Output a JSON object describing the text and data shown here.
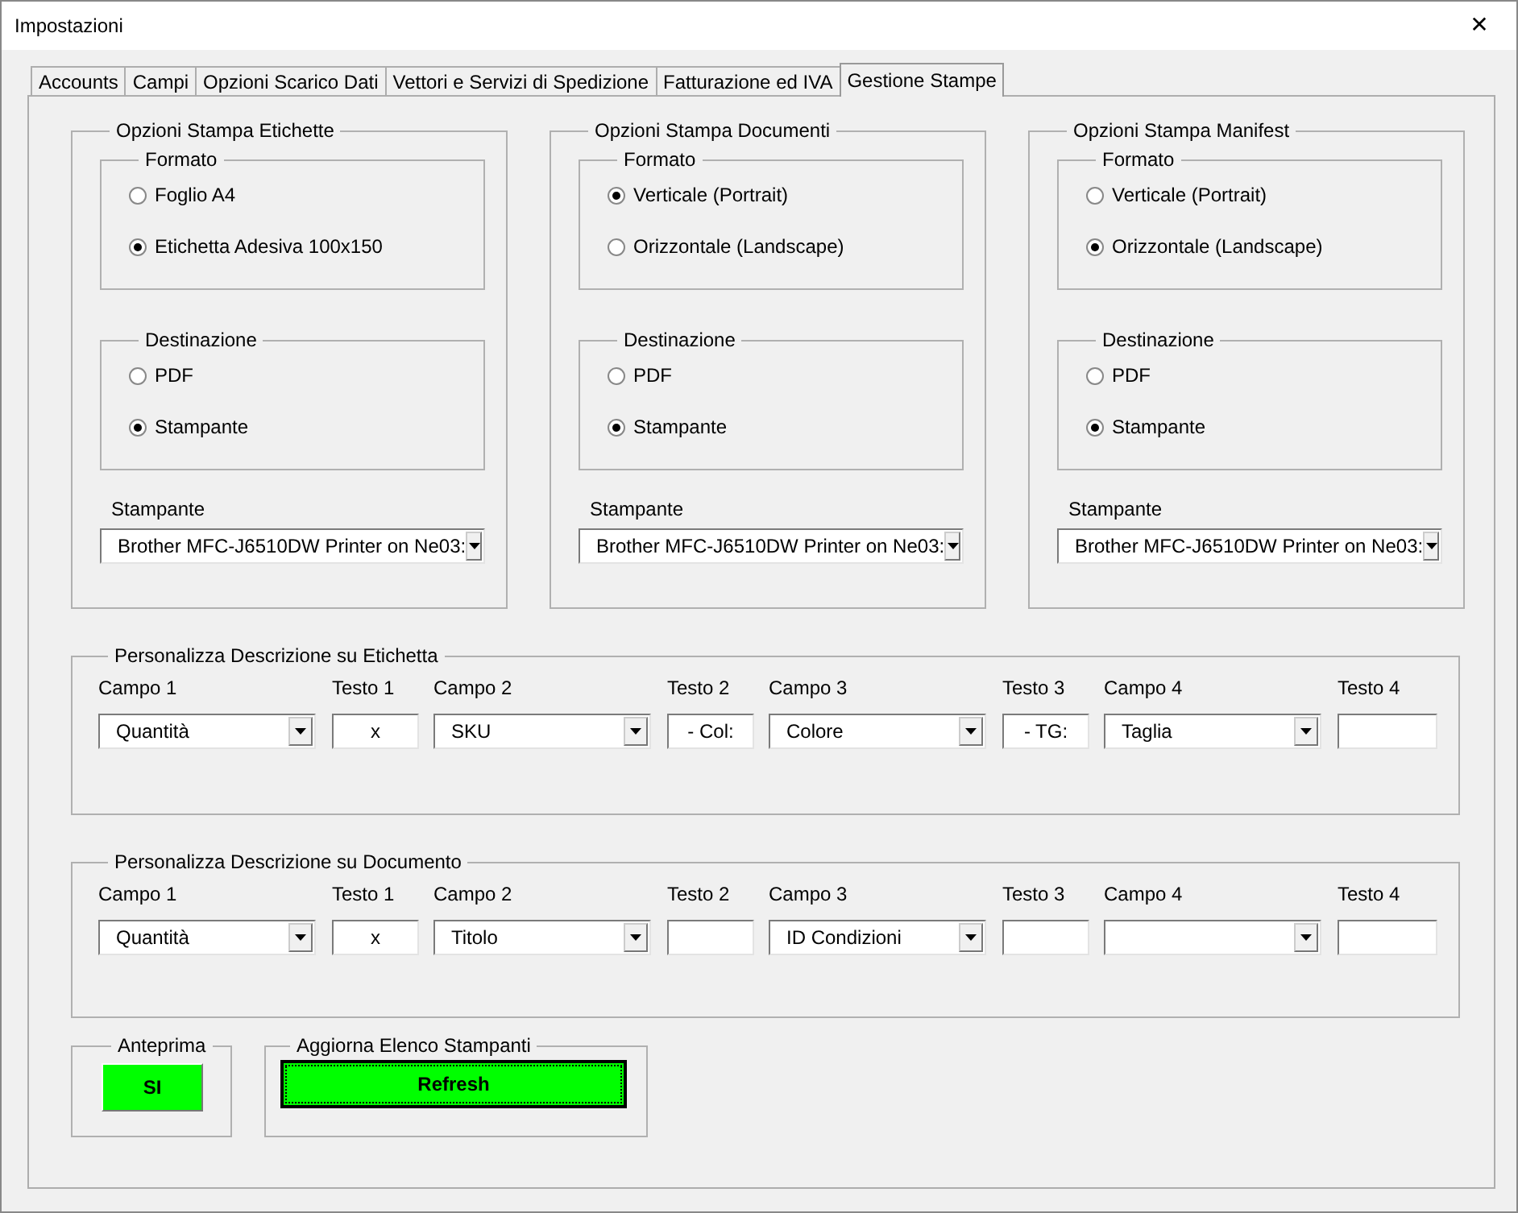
{
  "window": {
    "title": "Impostazioni",
    "close": "✕"
  },
  "tabs": [
    {
      "label": "Accounts",
      "selected": false
    },
    {
      "label": "Campi",
      "selected": false
    },
    {
      "label": "Opzioni Scarico Dati",
      "selected": false
    },
    {
      "label": "Vettori e Servizi di Spedizione",
      "selected": false
    },
    {
      "label": "Fatturazione ed IVA",
      "selected": false
    },
    {
      "label": "Gestione Stampe",
      "selected": true
    }
  ],
  "print_options": [
    {
      "title": "Opzioni Stampa Etichette",
      "format": {
        "title": "Formato",
        "options": [
          {
            "label": "Foglio A4",
            "selected": false
          },
          {
            "label": "Etichetta Adesiva 100x150",
            "selected": true
          }
        ]
      },
      "destination": {
        "title": "Destinazione",
        "options": [
          {
            "label": "PDF",
            "selected": false
          },
          {
            "label": "Stampante",
            "selected": true
          }
        ]
      },
      "printer_label": "Stampante",
      "printer": "Brother MFC-J6510DW Printer on Ne03:"
    },
    {
      "title": "Opzioni Stampa Documenti",
      "format": {
        "title": "Formato",
        "options": [
          {
            "label": "Verticale (Portrait)",
            "selected": true
          },
          {
            "label": "Orizzontale (Landscape)",
            "selected": false
          }
        ]
      },
      "destination": {
        "title": "Destinazione",
        "options": [
          {
            "label": "PDF",
            "selected": false
          },
          {
            "label": "Stampante",
            "selected": true
          }
        ]
      },
      "printer_label": "Stampante",
      "printer": "Brother MFC-J6510DW Printer on Ne03:"
    },
    {
      "title": "Opzioni Stampa Manifest",
      "format": {
        "title": "Formato",
        "options": [
          {
            "label": "Verticale (Portrait)",
            "selected": false
          },
          {
            "label": "Orizzontale (Landscape)",
            "selected": true
          }
        ]
      },
      "destination": {
        "title": "Destinazione",
        "options": [
          {
            "label": "PDF",
            "selected": false
          },
          {
            "label": "Stampante",
            "selected": true
          }
        ]
      },
      "printer_label": "Stampante",
      "printer": "Brother MFC-J6510DW Printer on Ne03:"
    }
  ],
  "descriptions": [
    {
      "title": "Personalizza Descrizione su Etichetta",
      "fields": [
        {
          "kind": "combo",
          "label": "Campo 1",
          "value": "Quantità"
        },
        {
          "kind": "text",
          "label": "Testo 1",
          "value": "x"
        },
        {
          "kind": "combo",
          "label": "Campo 2",
          "value": "SKU"
        },
        {
          "kind": "text",
          "label": "Testo 2",
          "value": "- Col:"
        },
        {
          "kind": "combo",
          "label": "Campo 3",
          "value": "Colore"
        },
        {
          "kind": "text",
          "label": "Testo 3",
          "value": "- TG:"
        },
        {
          "kind": "combo",
          "label": "Campo 4",
          "value": "Taglia"
        },
        {
          "kind": "text",
          "label": "Testo 4"
        }
      ]
    },
    {
      "title": "Personalizza Descrizione su Documento",
      "fields": [
        {
          "kind": "combo",
          "label": "Campo 1",
          "value": "Quantità"
        },
        {
          "kind": "text",
          "label": "Testo 1",
          "value": "x"
        },
        {
          "kind": "combo",
          "label": "Campo 2",
          "value": "Titolo"
        },
        {
          "kind": "text",
          "label": "Testo 2"
        },
        {
          "kind": "combo",
          "label": "Campo 3",
          "value": "ID Condizioni"
        },
        {
          "kind": "text",
          "label": "Testo 3"
        },
        {
          "kind": "combo",
          "label": "Campo 4"
        },
        {
          "kind": "text",
          "label": "Testo 4"
        }
      ]
    }
  ],
  "preview": {
    "title": "Anteprima",
    "button": {
      "label": "SI",
      "focused": false
    }
  },
  "refresh": {
    "title": "Aggiorna Elenco Stampanti",
    "button": {
      "label": "Refresh",
      "focused": true
    }
  }
}
